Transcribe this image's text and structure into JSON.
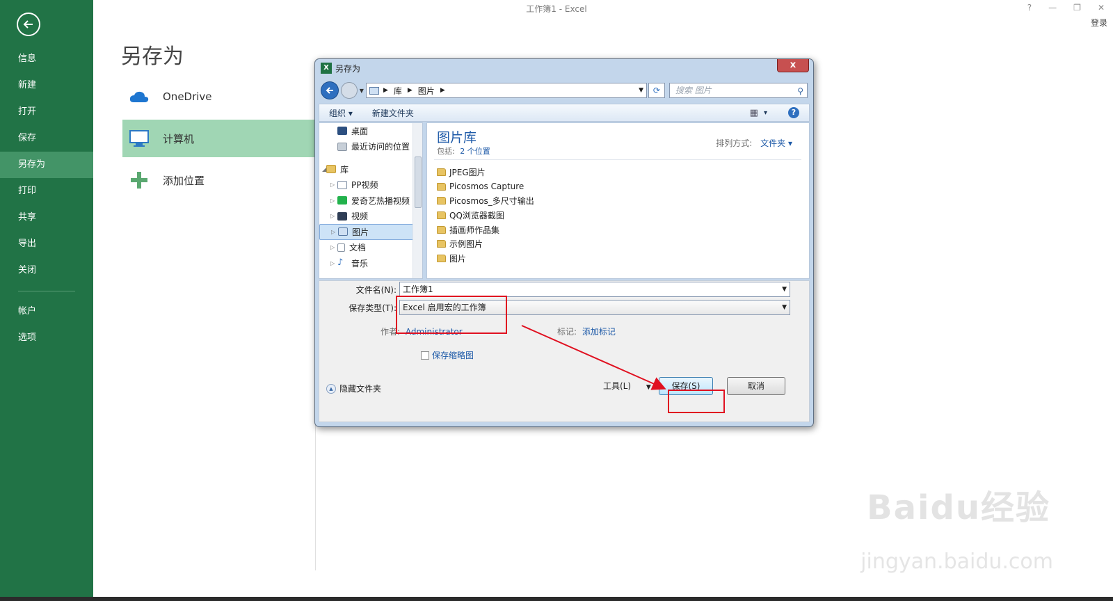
{
  "window": {
    "title": "工作簿1 - Excel",
    "controls": [
      "?",
      "—",
      "❐",
      "✕"
    ],
    "login": "登录"
  },
  "sidebar": {
    "items": [
      {
        "label": "信息"
      },
      {
        "label": "新建"
      },
      {
        "label": "打开"
      },
      {
        "label": "保存"
      },
      {
        "label": "另存为",
        "active": true
      },
      {
        "label": "打印"
      },
      {
        "label": "共享"
      },
      {
        "label": "导出"
      },
      {
        "label": "关闭"
      }
    ],
    "bottom_items": [
      {
        "label": "帐户"
      },
      {
        "label": "选项"
      }
    ]
  },
  "main": {
    "title": "另存为",
    "places": [
      {
        "label": "OneDrive",
        "icon": "cloud-icon"
      },
      {
        "label": "计算机",
        "icon": "computer-icon",
        "selected": true
      },
      {
        "label": "添加位置",
        "icon": "plus-icon"
      }
    ]
  },
  "dialog": {
    "title": "另存为",
    "close": "x",
    "address": {
      "crumbs": [
        "库",
        "图片"
      ],
      "search_placeholder": "搜索 图片"
    },
    "toolbar": {
      "organize": "组织 ▾",
      "new_folder": "新建文件夹",
      "view": "▾",
      "help": "?"
    },
    "nav_pane": {
      "favorites": [
        {
          "label": "桌面",
          "icon": "desktop-icon"
        },
        {
          "label": "最近访问的位置",
          "icon": "recent-places-icon"
        }
      ],
      "library": {
        "label": "库",
        "icon": "library-icon"
      },
      "library_items": [
        {
          "label": "PP视频",
          "icon": "pp-video-icon"
        },
        {
          "label": "爱奇艺热播视频",
          "icon": "iqiyi-icon"
        },
        {
          "label": "视频",
          "icon": "video-icon"
        },
        {
          "label": "图片",
          "icon": "pictures-icon",
          "selected": true
        },
        {
          "label": "文档",
          "icon": "documents-icon"
        },
        {
          "label": "音乐",
          "icon": "music-icon"
        }
      ]
    },
    "file_pane": {
      "library_title": "图片库",
      "includes_label": "包括:",
      "includes_link": "2 个位置",
      "sort_label": "排列方式:",
      "sort_value": "文件夹 ▾",
      "folders": [
        "JPEG图片",
        "Picosmos Capture",
        "Picosmos_多尺寸输出",
        "QQ浏览器截图",
        "插画师作品集",
        "示例图片",
        "图片"
      ]
    },
    "form": {
      "filename_label": "文件名(N):",
      "filename_value": "工作簿1",
      "filetype_label": "保存类型(T):",
      "filetype_value": "Excel 启用宏的工作簿",
      "author_label": "作者:",
      "author_value": "Administrator",
      "tags_label": "标记:",
      "tags_value": "添加标记",
      "thumbnail_label": "保存缩略图"
    },
    "footer": {
      "hide_folders": "隐藏文件夹",
      "tools": "工具(L)",
      "save": "保存(S)",
      "cancel": "取消"
    }
  },
  "watermark": {
    "main": "Baidu经验",
    "sub": "jingyan.baidu.com"
  },
  "colors": {
    "excel_green": "#217346",
    "sidebar_active": "#439467",
    "place_selected": "#a0d6b4",
    "annotation_red": "#e01020",
    "link_blue": "#1e5aa8"
  }
}
